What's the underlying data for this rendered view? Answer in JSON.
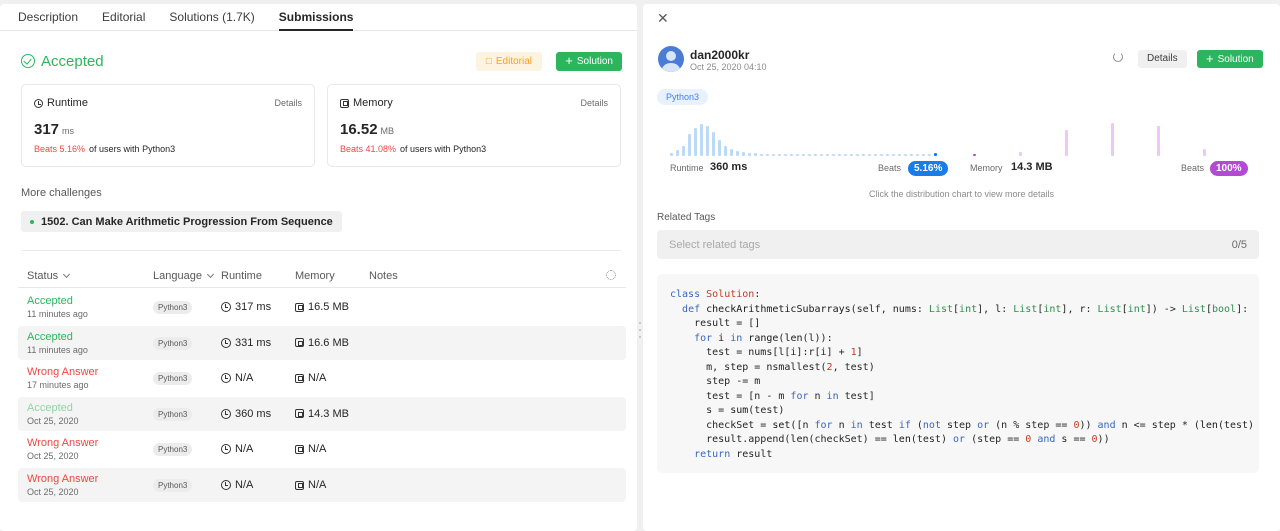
{
  "left": {
    "tabs": [
      "Description",
      "Editorial",
      "Solutions (1.7K)",
      "Submissions"
    ],
    "result": {
      "status": "Accepted",
      "editorial_label": "Editorial",
      "solution_label": "Solution"
    },
    "runtime_card": {
      "label": "Runtime",
      "details": "Details",
      "value": "317",
      "unit": "ms",
      "beats_pct": "Beats 5.16%",
      "beats_text": "of users with Python3"
    },
    "memory_card": {
      "label": "Memory",
      "details": "Details",
      "value": "16.52",
      "unit": "MB",
      "beats_pct": "Beats 41.08%",
      "beats_text": "of users with Python3"
    },
    "more_challenges_label": "More challenges",
    "challenge": "1502. Can Make Arithmetic Progression From Sequence",
    "table": {
      "headers": {
        "status": "Status",
        "language": "Language",
        "runtime": "Runtime",
        "memory": "Memory",
        "notes": "Notes"
      },
      "rows": [
        {
          "status": "Accepted",
          "time": "11 minutes ago",
          "lang": "Python3",
          "runtime": "317 ms",
          "memory": "16.5 MB",
          "color": "#2db55d"
        },
        {
          "status": "Accepted",
          "time": "11 minutes ago",
          "lang": "Python3",
          "runtime": "331 ms",
          "memory": "16.6 MB",
          "color": "#2db55d"
        },
        {
          "status": "Wrong Answer",
          "time": "17 minutes ago",
          "lang": "Python3",
          "runtime": "N/A",
          "memory": "N/A",
          "color": "#ef4743"
        },
        {
          "status": "Accepted",
          "time": "Oct 25, 2020",
          "lang": "Python3",
          "runtime": "360 ms",
          "memory": "14.3 MB",
          "color": "#8fd6a6"
        },
        {
          "status": "Wrong Answer",
          "time": "Oct 25, 2020",
          "lang": "Python3",
          "runtime": "N/A",
          "memory": "N/A",
          "color": "#ef4743"
        },
        {
          "status": "Wrong Answer",
          "time": "Oct 25, 2020",
          "lang": "Python3",
          "runtime": "N/A",
          "memory": "N/A",
          "color": "#ef4743"
        }
      ]
    }
  },
  "right": {
    "username": "dan2000kr",
    "date": "Oct 25, 2020 04:10",
    "details_label": "Details",
    "solution_label": "Solution",
    "language": "Python3",
    "runtime_label": "Runtime",
    "runtime_value": "360 ms",
    "runtime_beats_label": "Beats",
    "runtime_beats": "5.16%",
    "memory_label": "Memory",
    "memory_value": "14.3 MB",
    "memory_beats_label": "Beats",
    "memory_beats": "100%",
    "hint": "Click the distribution chart to view more details",
    "related_tags_label": "Related Tags",
    "tags_placeholder": "Select related tags",
    "tags_count": "0/5",
    "colors": {
      "runtime": "#1a7ce6",
      "memory": "#b34ad4"
    }
  }
}
